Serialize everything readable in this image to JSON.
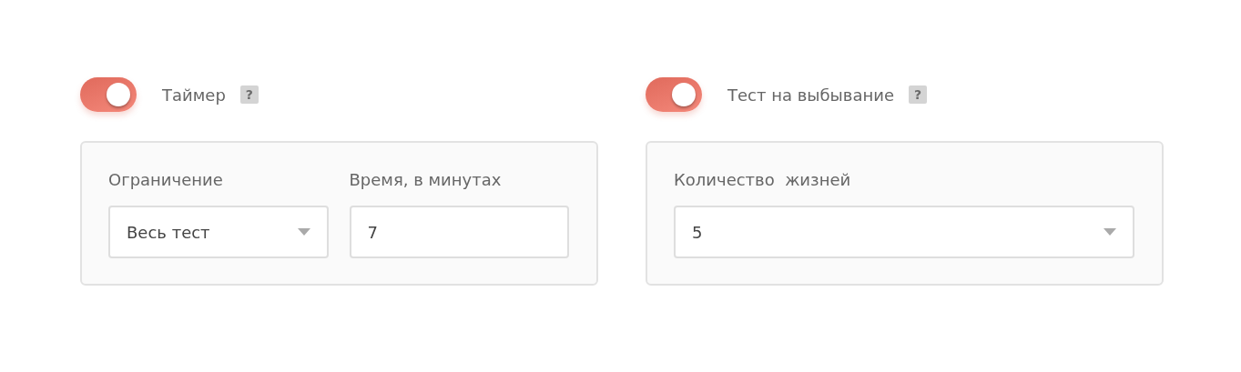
{
  "sections": [
    {
      "toggle": {
        "on": true
      },
      "title": "Таймер",
      "help": "?",
      "fields": [
        {
          "kind": "select",
          "label": "Ограничение",
          "value": "Весь тест"
        },
        {
          "kind": "input",
          "label": "Время, в минутах",
          "value": "7"
        }
      ]
    },
    {
      "toggle": {
        "on": true
      },
      "title": "Тест на выбывание",
      "help": "?",
      "fields": [
        {
          "kind": "select",
          "label": "Количество  жизней",
          "value": "5"
        }
      ]
    }
  ]
}
